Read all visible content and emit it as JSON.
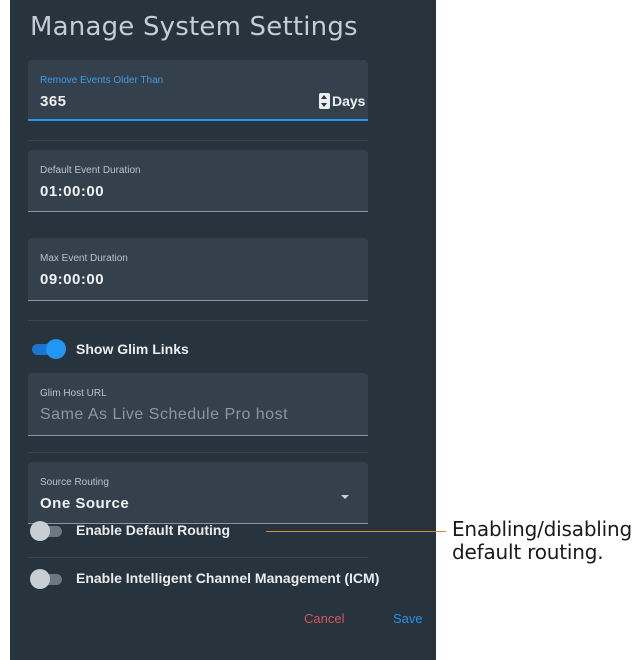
{
  "dialog": {
    "title": "Manage System Settings",
    "remove_events": {
      "label": "Remove Events Older Than",
      "value": "365",
      "unit": "Days"
    },
    "default_duration": {
      "label": "Default Event Duration",
      "value": "01:00:00"
    },
    "max_duration": {
      "label": "Max Event Duration",
      "value": "09:00:00"
    },
    "glim_links": {
      "label": "Show Glim Links",
      "enabled": true
    },
    "glim_host": {
      "label": "Glim Host URL",
      "placeholder": "Same As Live Schedule Pro host"
    },
    "source_routing": {
      "label": "Source Routing",
      "value": "One Source"
    },
    "default_routing": {
      "label": "Enable Default Routing",
      "enabled": false
    },
    "icm": {
      "label": "Enable Intelligent Channel Management (ICM)",
      "enabled": false
    },
    "buttons": {
      "cancel": "Cancel",
      "save": "Save"
    }
  },
  "callout": {
    "line1": "Enabling/disabling",
    "line2": "default routing."
  },
  "colors": {
    "panel": "#27333d",
    "field": "#34414c",
    "accent": "#2196f3",
    "cancel": "#d65555",
    "callout_line": "#d98a3c"
  }
}
